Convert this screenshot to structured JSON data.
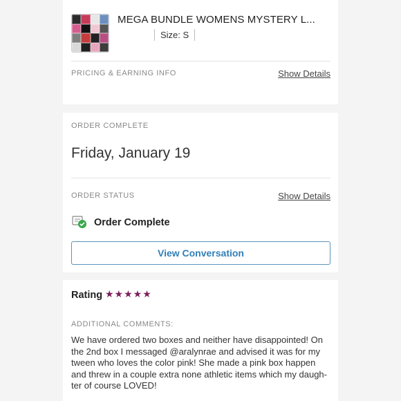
{
  "product": {
    "title": "MEGA BUNDLE WOMENS MYSTERY L...",
    "size": "Size: S",
    "thumb_colors": [
      "#2b2b2b",
      "#c83a5a",
      "#e7e7e7",
      "#6c8fbf",
      "#d65d8f",
      "#111111",
      "#f0c7d3",
      "#555555",
      "#7f7f7f",
      "#c63b3b",
      "#222222",
      "#b64e82",
      "#d9d9d9",
      "#1f1f1f",
      "#e8a5be",
      "#3c3c3c"
    ]
  },
  "pricing": {
    "label": "PRICING & EARNING INFO",
    "link": "Show Details"
  },
  "order": {
    "complete_label": "ORDER COMPLETE",
    "date": "Friday, January 19",
    "status_label": "ORDER STATUS",
    "status_link": "Show Details",
    "status_text": "Order Complete",
    "status_icon": "order-complete-icon",
    "button_label": "View Conversation"
  },
  "rating": {
    "label": "Rating",
    "stars": "★★★★★",
    "star_count": 5,
    "comments_label": "ADDITIONAL COMMENTS:",
    "comment": "We have ordered two boxes and neither have disappointed! On the 2nd box I messaged @aralynrae and advised it was for my tween who loves the color pink! She made a pink box happen and threw in a couple extra none athletic items which my daugh- ter of course LOVED!"
  },
  "colors": {
    "accent_blue": "#2f7fb8",
    "star_color": "#7a1d5b",
    "check_green": "#3aa84a"
  }
}
